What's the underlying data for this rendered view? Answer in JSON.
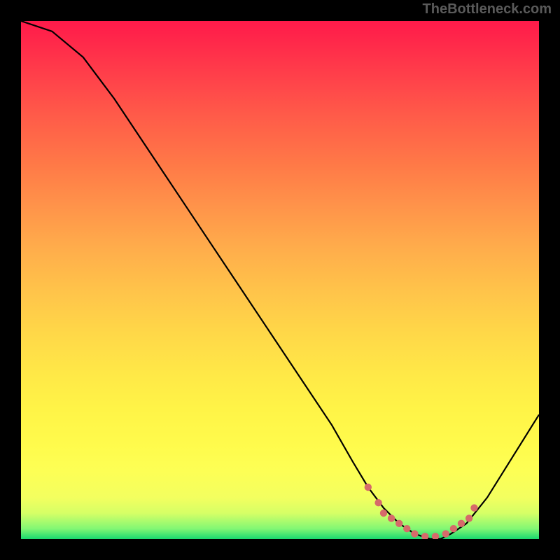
{
  "watermark": "TheBottleneck.com",
  "chart_data": {
    "type": "line",
    "title": "",
    "xlabel": "",
    "ylabel": "",
    "xlim": [
      0,
      100
    ],
    "ylim": [
      0,
      100
    ],
    "grid": false,
    "series": [
      {
        "name": "curve",
        "x": [
          0,
          6,
          12,
          18,
          24,
          30,
          36,
          42,
          48,
          54,
          60,
          64,
          67,
          70,
          73,
          76,
          79,
          81,
          83,
          86,
          90,
          95,
          100
        ],
        "values": [
          100,
          98,
          93,
          85,
          76,
          67,
          58,
          49,
          40,
          31,
          22,
          15,
          10,
          6,
          3,
          1,
          0,
          0,
          1,
          3,
          8,
          16,
          24
        ]
      }
    ],
    "markers": [
      {
        "x": 67,
        "y": 10
      },
      {
        "x": 69,
        "y": 7
      },
      {
        "x": 70,
        "y": 5
      },
      {
        "x": 71.5,
        "y": 4
      },
      {
        "x": 73,
        "y": 3
      },
      {
        "x": 74.5,
        "y": 2
      },
      {
        "x": 76,
        "y": 1
      },
      {
        "x": 78,
        "y": 0.5
      },
      {
        "x": 80,
        "y": 0.5
      },
      {
        "x": 82,
        "y": 1
      },
      {
        "x": 83.5,
        "y": 2
      },
      {
        "x": 85,
        "y": 3
      },
      {
        "x": 86.5,
        "y": 4
      },
      {
        "x": 87.5,
        "y": 6
      }
    ],
    "accent_color": "#d66a6a",
    "curve_color": "#000000"
  }
}
